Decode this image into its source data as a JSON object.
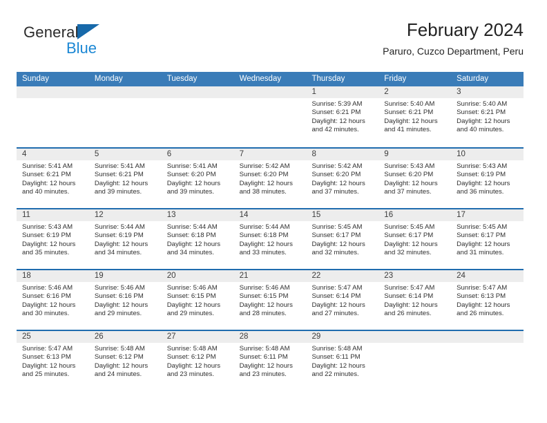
{
  "brand": {
    "name_part1": "General",
    "name_part2": "Blue",
    "triangle_icon": "brand-triangle-icon",
    "color_dark": "#2b2b2b",
    "color_blue": "#1b87d4",
    "color_triangle": "#1769aa"
  },
  "header": {
    "title": "February 2024",
    "subtitle": "Paruro, Cuzco Department, Peru"
  },
  "theme": {
    "header_blue": "#3a7cb8",
    "row_rule_blue": "#1f6cae",
    "day_band_gray": "#ededed",
    "text_dark": "#2f2f2f"
  },
  "weekdays": [
    "Sunday",
    "Monday",
    "Tuesday",
    "Wednesday",
    "Thursday",
    "Friday",
    "Saturday"
  ],
  "weeks": [
    [
      {
        "day": "",
        "sunrise": "",
        "sunset": "",
        "daylight_line1": "",
        "daylight_line2": "",
        "empty": true
      },
      {
        "day": "",
        "sunrise": "",
        "sunset": "",
        "daylight_line1": "",
        "daylight_line2": "",
        "empty": true
      },
      {
        "day": "",
        "sunrise": "",
        "sunset": "",
        "daylight_line1": "",
        "daylight_line2": "",
        "empty": true
      },
      {
        "day": "",
        "sunrise": "",
        "sunset": "",
        "daylight_line1": "",
        "daylight_line2": "",
        "empty": true
      },
      {
        "day": "1",
        "sunrise": "Sunrise: 5:39 AM",
        "sunset": "Sunset: 6:21 PM",
        "daylight_line1": "Daylight: 12 hours",
        "daylight_line2": "and 42 minutes.",
        "empty": false
      },
      {
        "day": "2",
        "sunrise": "Sunrise: 5:40 AM",
        "sunset": "Sunset: 6:21 PM",
        "daylight_line1": "Daylight: 12 hours",
        "daylight_line2": "and 41 minutes.",
        "empty": false
      },
      {
        "day": "3",
        "sunrise": "Sunrise: 5:40 AM",
        "sunset": "Sunset: 6:21 PM",
        "daylight_line1": "Daylight: 12 hours",
        "daylight_line2": "and 40 minutes.",
        "empty": false
      }
    ],
    [
      {
        "day": "4",
        "sunrise": "Sunrise: 5:41 AM",
        "sunset": "Sunset: 6:21 PM",
        "daylight_line1": "Daylight: 12 hours",
        "daylight_line2": "and 40 minutes.",
        "empty": false
      },
      {
        "day": "5",
        "sunrise": "Sunrise: 5:41 AM",
        "sunset": "Sunset: 6:21 PM",
        "daylight_line1": "Daylight: 12 hours",
        "daylight_line2": "and 39 minutes.",
        "empty": false
      },
      {
        "day": "6",
        "sunrise": "Sunrise: 5:41 AM",
        "sunset": "Sunset: 6:20 PM",
        "daylight_line1": "Daylight: 12 hours",
        "daylight_line2": "and 39 minutes.",
        "empty": false
      },
      {
        "day": "7",
        "sunrise": "Sunrise: 5:42 AM",
        "sunset": "Sunset: 6:20 PM",
        "daylight_line1": "Daylight: 12 hours",
        "daylight_line2": "and 38 minutes.",
        "empty": false
      },
      {
        "day": "8",
        "sunrise": "Sunrise: 5:42 AM",
        "sunset": "Sunset: 6:20 PM",
        "daylight_line1": "Daylight: 12 hours",
        "daylight_line2": "and 37 minutes.",
        "empty": false
      },
      {
        "day": "9",
        "sunrise": "Sunrise: 5:43 AM",
        "sunset": "Sunset: 6:20 PM",
        "daylight_line1": "Daylight: 12 hours",
        "daylight_line2": "and 37 minutes.",
        "empty": false
      },
      {
        "day": "10",
        "sunrise": "Sunrise: 5:43 AM",
        "sunset": "Sunset: 6:19 PM",
        "daylight_line1": "Daylight: 12 hours",
        "daylight_line2": "and 36 minutes.",
        "empty": false
      }
    ],
    [
      {
        "day": "11",
        "sunrise": "Sunrise: 5:43 AM",
        "sunset": "Sunset: 6:19 PM",
        "daylight_line1": "Daylight: 12 hours",
        "daylight_line2": "and 35 minutes.",
        "empty": false
      },
      {
        "day": "12",
        "sunrise": "Sunrise: 5:44 AM",
        "sunset": "Sunset: 6:19 PM",
        "daylight_line1": "Daylight: 12 hours",
        "daylight_line2": "and 34 minutes.",
        "empty": false
      },
      {
        "day": "13",
        "sunrise": "Sunrise: 5:44 AM",
        "sunset": "Sunset: 6:18 PM",
        "daylight_line1": "Daylight: 12 hours",
        "daylight_line2": "and 34 minutes.",
        "empty": false
      },
      {
        "day": "14",
        "sunrise": "Sunrise: 5:44 AM",
        "sunset": "Sunset: 6:18 PM",
        "daylight_line1": "Daylight: 12 hours",
        "daylight_line2": "and 33 minutes.",
        "empty": false
      },
      {
        "day": "15",
        "sunrise": "Sunrise: 5:45 AM",
        "sunset": "Sunset: 6:17 PM",
        "daylight_line1": "Daylight: 12 hours",
        "daylight_line2": "and 32 minutes.",
        "empty": false
      },
      {
        "day": "16",
        "sunrise": "Sunrise: 5:45 AM",
        "sunset": "Sunset: 6:17 PM",
        "daylight_line1": "Daylight: 12 hours",
        "daylight_line2": "and 32 minutes.",
        "empty": false
      },
      {
        "day": "17",
        "sunrise": "Sunrise: 5:45 AM",
        "sunset": "Sunset: 6:17 PM",
        "daylight_line1": "Daylight: 12 hours",
        "daylight_line2": "and 31 minutes.",
        "empty": false
      }
    ],
    [
      {
        "day": "18",
        "sunrise": "Sunrise: 5:46 AM",
        "sunset": "Sunset: 6:16 PM",
        "daylight_line1": "Daylight: 12 hours",
        "daylight_line2": "and 30 minutes.",
        "empty": false
      },
      {
        "day": "19",
        "sunrise": "Sunrise: 5:46 AM",
        "sunset": "Sunset: 6:16 PM",
        "daylight_line1": "Daylight: 12 hours",
        "daylight_line2": "and 29 minutes.",
        "empty": false
      },
      {
        "day": "20",
        "sunrise": "Sunrise: 5:46 AM",
        "sunset": "Sunset: 6:15 PM",
        "daylight_line1": "Daylight: 12 hours",
        "daylight_line2": "and 29 minutes.",
        "empty": false
      },
      {
        "day": "21",
        "sunrise": "Sunrise: 5:46 AM",
        "sunset": "Sunset: 6:15 PM",
        "daylight_line1": "Daylight: 12 hours",
        "daylight_line2": "and 28 minutes.",
        "empty": false
      },
      {
        "day": "22",
        "sunrise": "Sunrise: 5:47 AM",
        "sunset": "Sunset: 6:14 PM",
        "daylight_line1": "Daylight: 12 hours",
        "daylight_line2": "and 27 minutes.",
        "empty": false
      },
      {
        "day": "23",
        "sunrise": "Sunrise: 5:47 AM",
        "sunset": "Sunset: 6:14 PM",
        "daylight_line1": "Daylight: 12 hours",
        "daylight_line2": "and 26 minutes.",
        "empty": false
      },
      {
        "day": "24",
        "sunrise": "Sunrise: 5:47 AM",
        "sunset": "Sunset: 6:13 PM",
        "daylight_line1": "Daylight: 12 hours",
        "daylight_line2": "and 26 minutes.",
        "empty": false
      }
    ],
    [
      {
        "day": "25",
        "sunrise": "Sunrise: 5:47 AM",
        "sunset": "Sunset: 6:13 PM",
        "daylight_line1": "Daylight: 12 hours",
        "daylight_line2": "and 25 minutes.",
        "empty": false
      },
      {
        "day": "26",
        "sunrise": "Sunrise: 5:48 AM",
        "sunset": "Sunset: 6:12 PM",
        "daylight_line1": "Daylight: 12 hours",
        "daylight_line2": "and 24 minutes.",
        "empty": false
      },
      {
        "day": "27",
        "sunrise": "Sunrise: 5:48 AM",
        "sunset": "Sunset: 6:12 PM",
        "daylight_line1": "Daylight: 12 hours",
        "daylight_line2": "and 23 minutes.",
        "empty": false
      },
      {
        "day": "28",
        "sunrise": "Sunrise: 5:48 AM",
        "sunset": "Sunset: 6:11 PM",
        "daylight_line1": "Daylight: 12 hours",
        "daylight_line2": "and 23 minutes.",
        "empty": false
      },
      {
        "day": "29",
        "sunrise": "Sunrise: 5:48 AM",
        "sunset": "Sunset: 6:11 PM",
        "daylight_line1": "Daylight: 12 hours",
        "daylight_line2": "and 22 minutes.",
        "empty": false
      },
      {
        "day": "",
        "sunrise": "",
        "sunset": "",
        "daylight_line1": "",
        "daylight_line2": "",
        "empty": true
      },
      {
        "day": "",
        "sunrise": "",
        "sunset": "",
        "daylight_line1": "",
        "daylight_line2": "",
        "empty": true
      }
    ]
  ]
}
